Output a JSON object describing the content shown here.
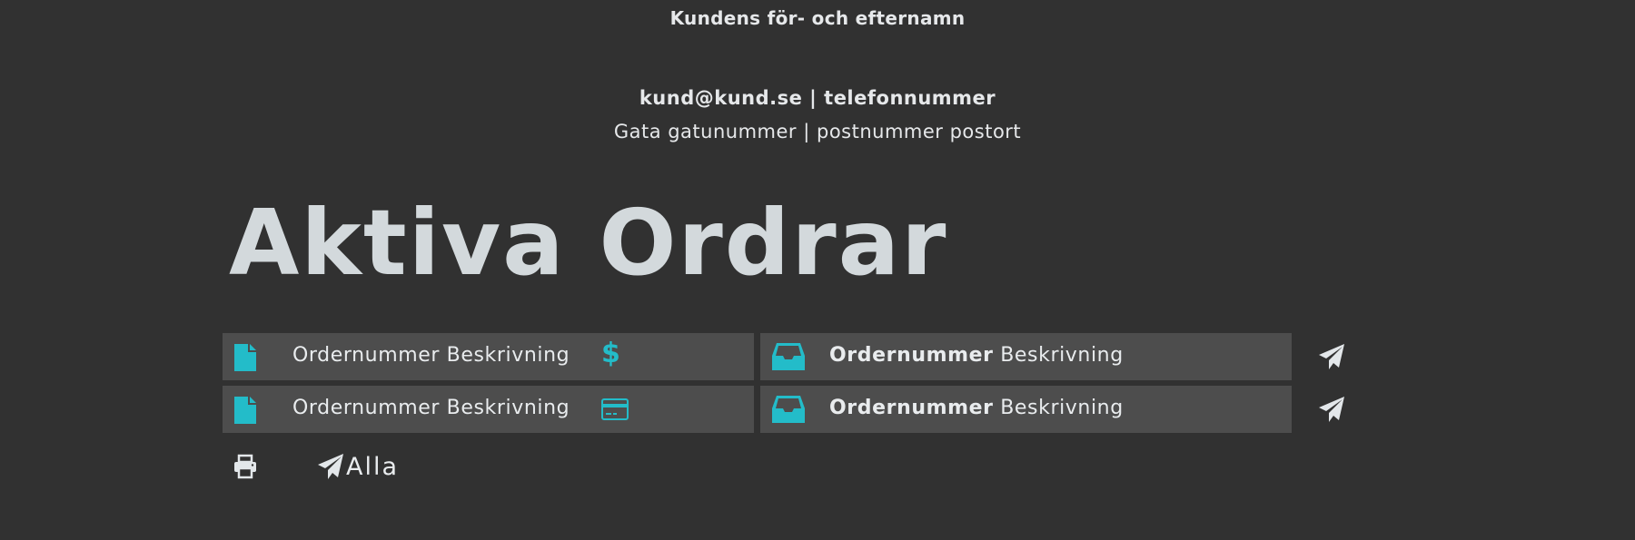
{
  "customer": {
    "name": "Kundens för- och efternamn",
    "contact": "kund@kund.se | telefonnummer",
    "address": "Gata gatunummer | postnummer postort"
  },
  "page_title": "Aktiva Ordrar",
  "colors": {
    "accent": "#23bcc9",
    "background": "#313131",
    "row_background": "#4d4d4d",
    "text": "#e4e7e9"
  },
  "orders": [
    {
      "left": {
        "icon": "file-icon",
        "text": "Ordernummer Beskrivning",
        "payment_icon": "dollar-icon",
        "payment_glyph": "$"
      },
      "right": {
        "icon": "inbox-icon",
        "order_number": "Ordernummer",
        "description": "Beskrivning"
      },
      "action_icon": "send-icon"
    },
    {
      "left": {
        "icon": "file-icon",
        "text": "Ordernummer Beskrivning",
        "payment_icon": "credit-card-icon"
      },
      "right": {
        "icon": "inbox-icon",
        "order_number": "Ordernummer",
        "description": "Beskrivning"
      },
      "action_icon": "send-icon"
    }
  ],
  "footer": {
    "print_icon": "print-icon",
    "send_all_icon": "send-icon",
    "send_all_label": "Alla"
  }
}
